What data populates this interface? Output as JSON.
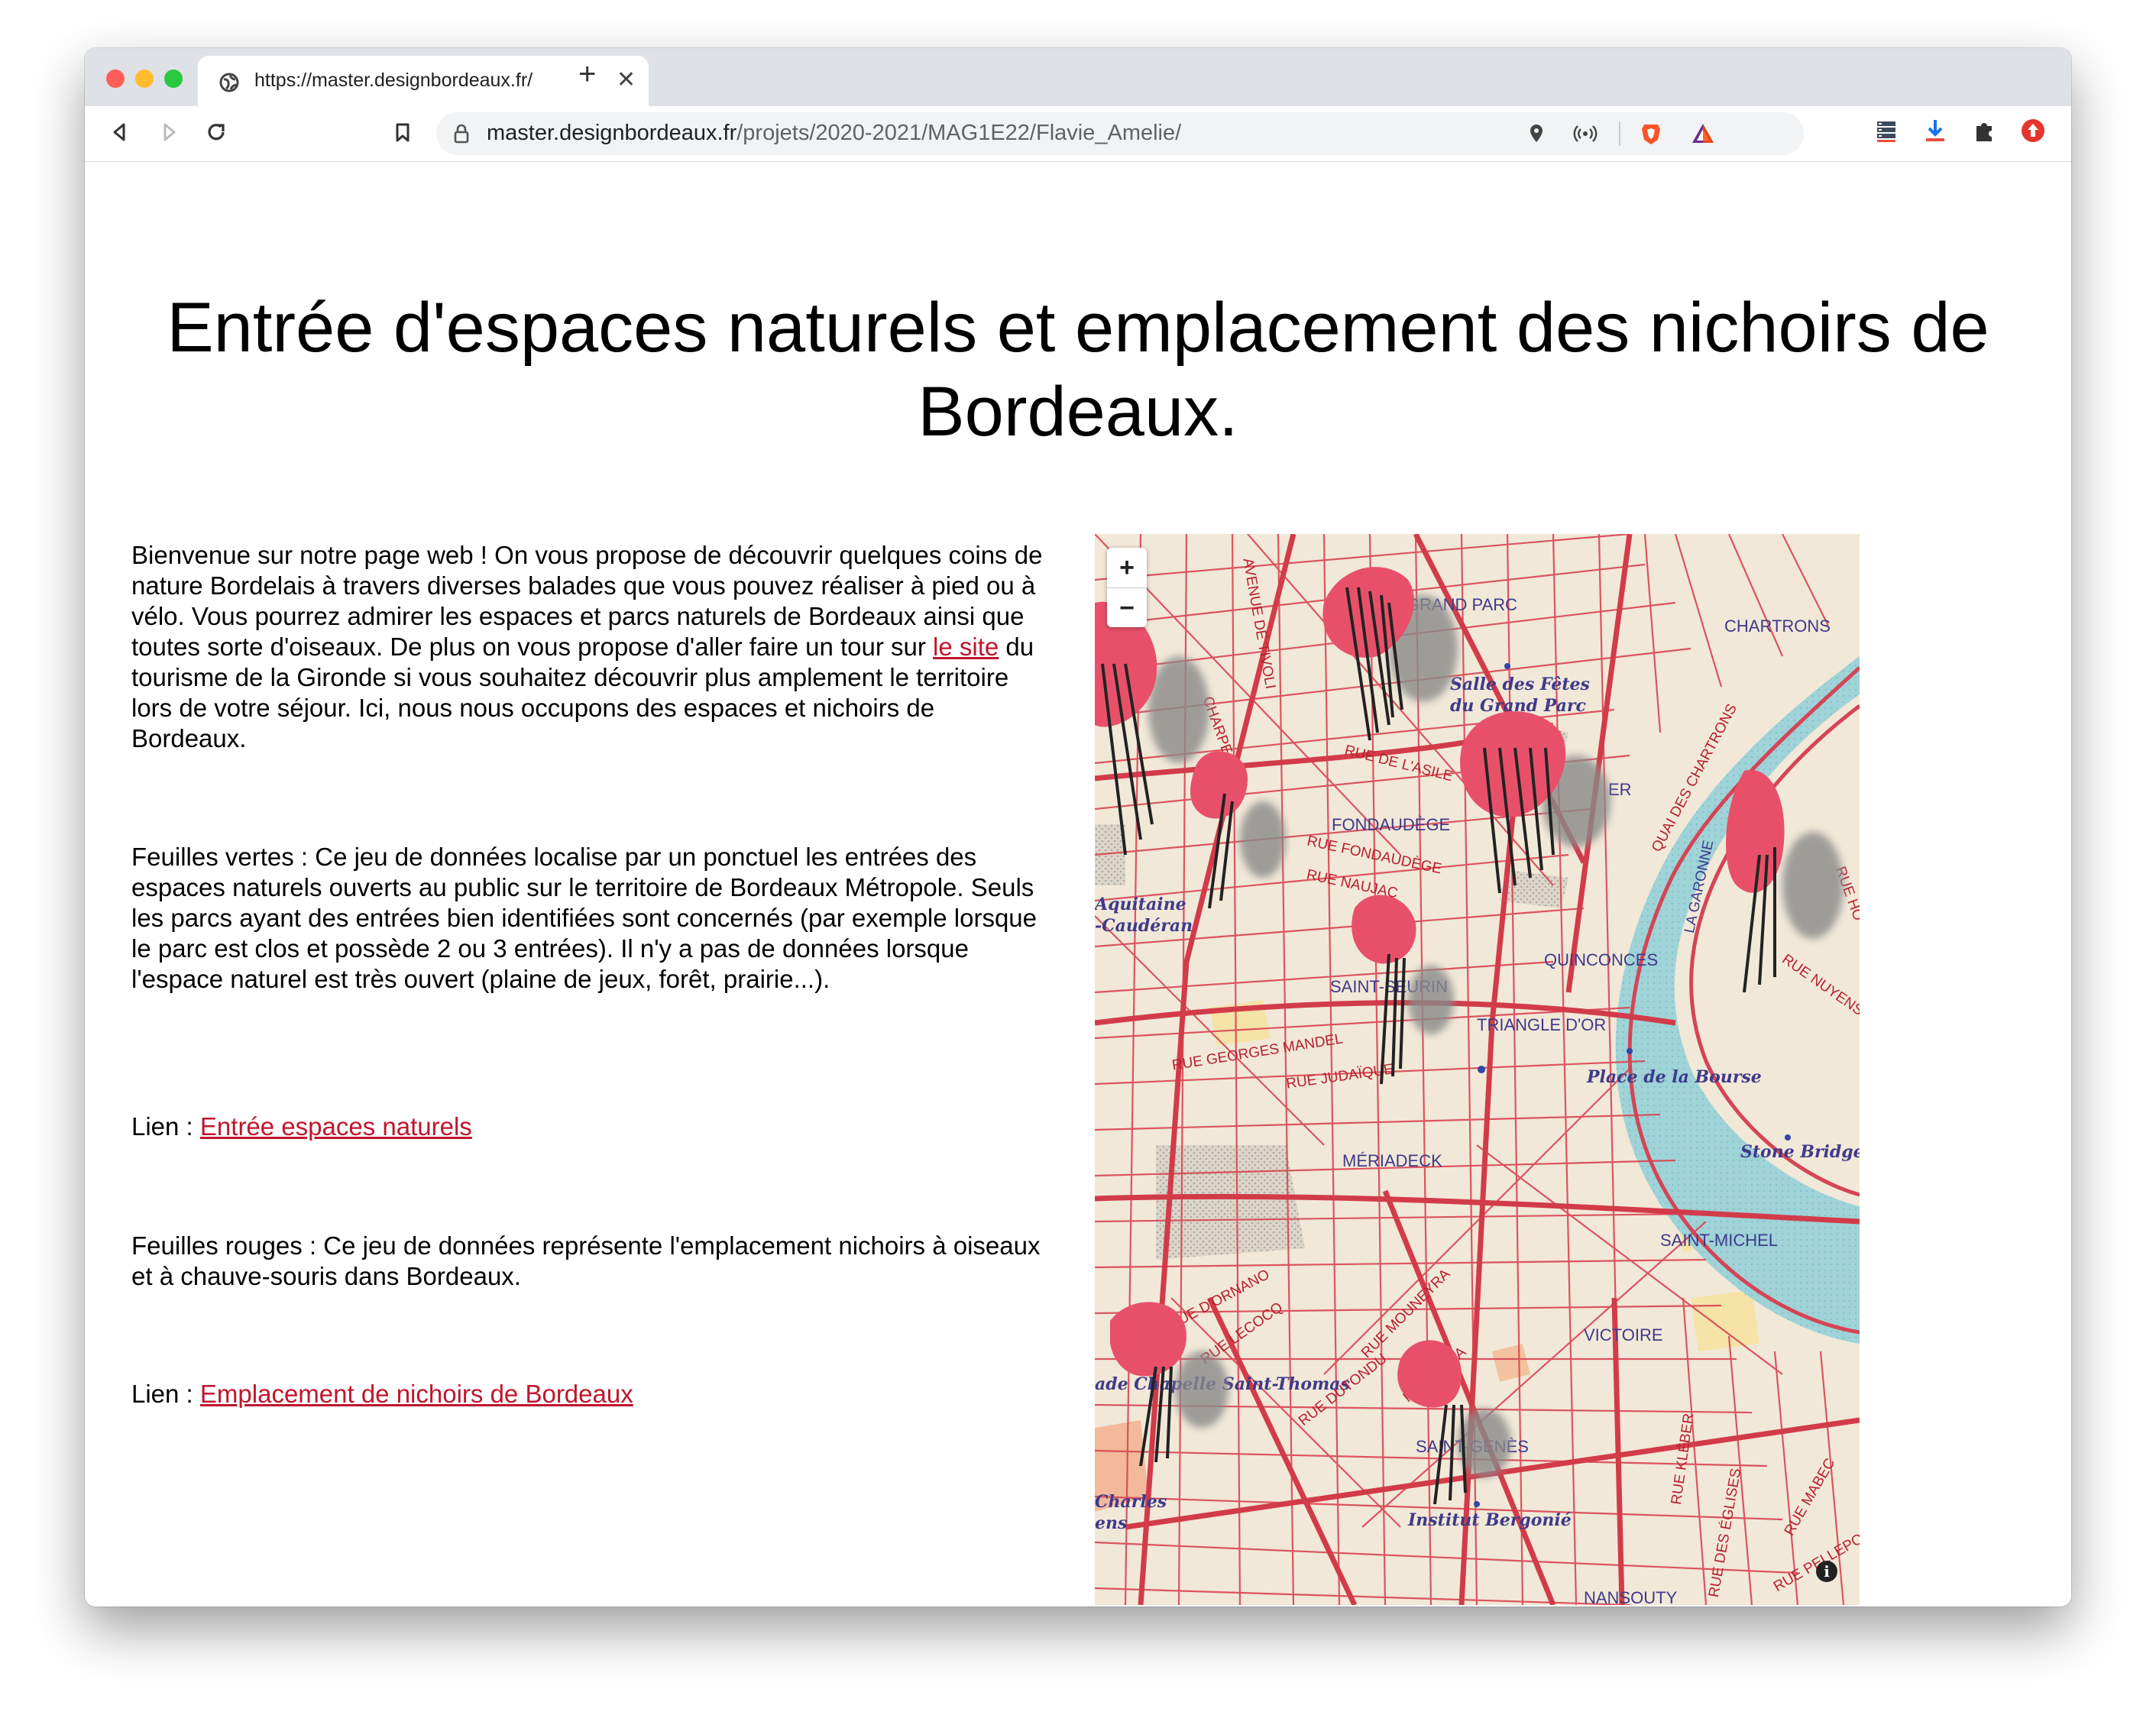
{
  "browser": {
    "tab_title": "https://master.designbordeaux.fr/",
    "tab_close": "✕",
    "new_tab": "+",
    "url_domain": "master.designbordeaux.fr",
    "url_path": "/projets/2020-2021/MAG1E22/Flavie_Amelie/"
  },
  "page": {
    "title": "Entrée d'espaces naturels et emplacement des nichoirs de Bordeaux.",
    "intro_before_link": "Bienvenue sur notre page web ! On vous propose de découvrir quelques coins de nature Bordelais à travers diverses balades que vous pouvez réaliser à pied ou à vélo. Vous pourrez admirer les espaces et parcs naturels de Bordeaux ainsi que toutes sorte d'oiseaux. De plus on vous propose d'aller faire un tour sur ",
    "intro_link": "le site",
    "intro_after_link": " du tourisme de la Gironde si vous souhaitez découvrir plus amplement le territoire lors de votre séjour. Ici, nous nous occupons des espaces et nichoirs de Bordeaux.",
    "green_text": "Feuilles vertes : Ce jeu de données localise par un ponctuel les entrées des espaces naturels ouverts au public sur le territoire de Bordeaux Métropole. Seuls les parcs ayant des entrées bien identifiées sont concernés (par exemple lorsque le parc est clos et possède 2 ou 3 entrées). Il n'y a pas de données lorsque l'espace naturel est très ouvert (plaine de jeux, forêt, prairie...).",
    "link_prefix": "Lien : ",
    "link1": "Entrée espaces naturels",
    "red_text": "Feuilles rouges : Ce jeu de données représente l'emplacement nichoirs à oiseaux et à chauve-souris dans Bordeaux.",
    "link2": "Emplacement de nichoirs de Bordeaux"
  },
  "map": {
    "zoom_in": "+",
    "zoom_out": "−",
    "info": "i",
    "labels": {
      "grand_parc": "GRAND PARC",
      "chartrons": "CHARTRONS",
      "salle_fetes_1": "Salle des Fêtes",
      "salle_fetes_2": "du Grand Parc",
      "fondaudege": "FONDAUDÈGE",
      "aquitaine": "Aquitaine",
      "cauderan": "-Caudéran",
      "quinconces": "QUINCONCES",
      "saint_seurin": "SAINT-SEURIN",
      "triangle": "TRIANGLE D'OR",
      "place_bourse": "Place de la Bourse",
      "meriadeck": "MÉRIADECK",
      "stone_bridge": "Stone Bridge",
      "saint_michel": "SAINT-MICHEL",
      "victoire": "VICTOIRE",
      "saint_genes": "SAINT-GENÈS",
      "institut": "Institut Bergonié",
      "charles_1": "Charles",
      "charles_2": "ens",
      "nansouty": "NANSOUTY",
      "garonne": "LA GARONNE",
      "rue_georges_mandel": "RUE GEORGES MANDEL",
      "rue_judaique": "RUE JUDAÏQUE",
      "quai_chartrons": "QUAI DES CHARTRONS",
      "rue_asile": "RUE DE L'ASILE",
      "rue_lecocq": "RUE LECOCQ",
      "rue_mouneyra": "RUE MOUNEYRA",
      "rue_dutondu": "RUE DUTONDU",
      "rue_kleber": "RUE KLÉBER",
      "rue_pelleport": "RUE PELLEPORT",
      "rue_ornano": "RUE D'ORNANO",
      "rue_nuyens": "RUE NUYENS",
      "avenue_tivoli": "AVENUE DE TIVOLI",
      "rue_naujac": "RUE NAUJAC",
      "rue_fondaudege": "RUE FONDAUDÈGE",
      "rue_mabec": "RUE MABEC",
      "rue_eglises": "RUE DES ÉGLISES",
      "rue_charpentier": "CHARPE",
      "chapelle": "ade Chapelle Saint-Thomas",
      "rue_hortense": "RUE HO",
      "rue_de_la": "RUE DE LA",
      "rue_de_lac": "RUE",
      "rue_quai": "ER"
    }
  }
}
